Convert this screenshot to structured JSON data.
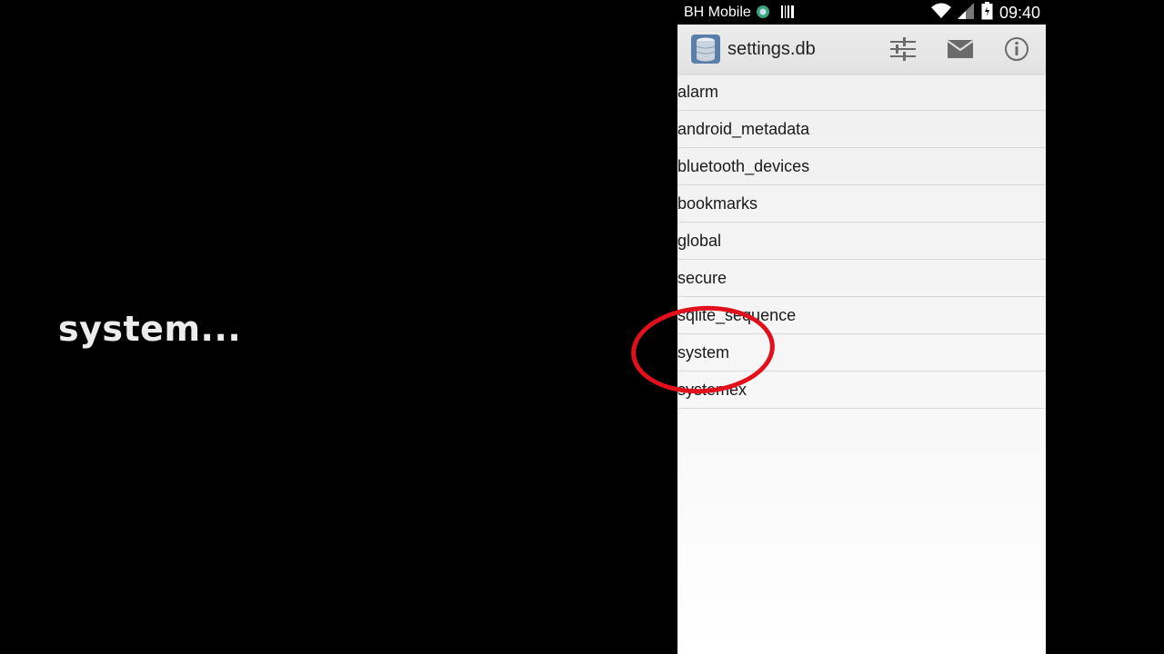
{
  "caption": "system...",
  "status_bar": {
    "carrier": "BH Mobile",
    "time": "09:40",
    "icons": [
      "carrier-app-icon",
      "barcode-icon",
      "wifi-icon",
      "signal-icon",
      "battery-icon"
    ]
  },
  "action_bar": {
    "title": "settings.db",
    "icons": [
      "database-icon",
      "sliders-icon",
      "mail-icon",
      "info-icon"
    ]
  },
  "tables": [
    "alarm",
    "android_metadata",
    "bluetooth_devices",
    "bookmarks",
    "global",
    "secure",
    "sqlite_sequence",
    "system",
    "systemex"
  ],
  "colors": {
    "highlight_circle": "#e1101b",
    "background": "#000000",
    "action_bar": "#e6e6e6"
  }
}
